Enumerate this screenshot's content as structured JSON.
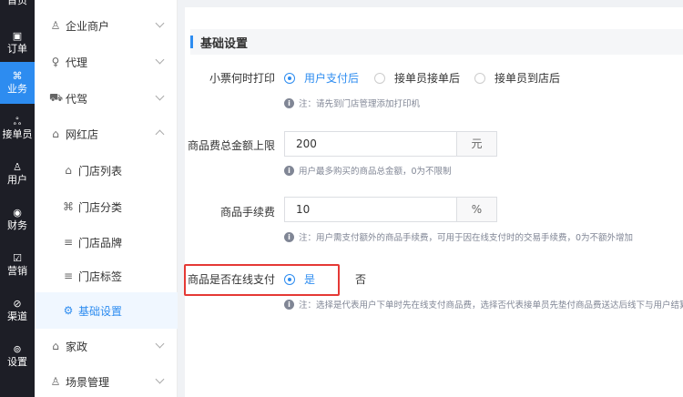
{
  "rail": {
    "items": [
      {
        "icon": "▣",
        "label": "订单"
      },
      {
        "icon": "⌘",
        "label": "业务"
      },
      {
        "icon": "ஃ",
        "label": "接单员"
      },
      {
        "icon": "♙",
        "label": "用户"
      },
      {
        "icon": "◉",
        "label": "财务"
      },
      {
        "icon": "☑",
        "label": "营销"
      },
      {
        "icon": "⊘",
        "label": "渠道"
      },
      {
        "icon": "⊚",
        "label": "设置"
      }
    ],
    "active_index": 1,
    "active_color": "#2d8cf0"
  },
  "menu": {
    "items": [
      {
        "icon": "♙",
        "label": "企业商户"
      },
      {
        "icon": "♀",
        "label": "代理"
      },
      {
        "icon": "⛟",
        "label": "代驾"
      },
      {
        "icon": "⌂",
        "label": "网红店"
      },
      {
        "icon": "⌂",
        "label": "门店列表"
      },
      {
        "icon": "⌘",
        "label": "门店分类"
      },
      {
        "icon": "≡",
        "label": "门店品牌"
      },
      {
        "icon": "≡",
        "label": "门店标签"
      },
      {
        "icon": "⚙",
        "label": "基础设置"
      },
      {
        "icon": "⌂",
        "label": "家政"
      },
      {
        "icon": "♙",
        "label": "场景管理"
      }
    ]
  },
  "page": {
    "title": "基础设置",
    "print_time": {
      "label": "小票何时打印",
      "options": [
        "用户支付后",
        "接单员接单后",
        "接单员到店后"
      ],
      "selected": "用户支付后",
      "hint": "注：请先到门店管理添加打印机"
    },
    "goods_limit": {
      "label": "商品费总金额上限",
      "value": "200",
      "unit": "元",
      "hint": "用户最多购买的商品总金额，0为不限制"
    },
    "goods_fee": {
      "label": "商品手续费",
      "value": "10",
      "unit": "%",
      "hint": "注：用户需支付额外的商品手续费，可用于因在线支付时的交易手续费，0为不额外增加"
    },
    "online_pay": {
      "label": "商品是否在线支付",
      "options": [
        "是",
        "否"
      ],
      "selected": "是",
      "hint": "注：选择是代表用户下单时先在线支付商品费，选择否代表接单员先垫付商品费送达后线下与用户结算"
    }
  }
}
